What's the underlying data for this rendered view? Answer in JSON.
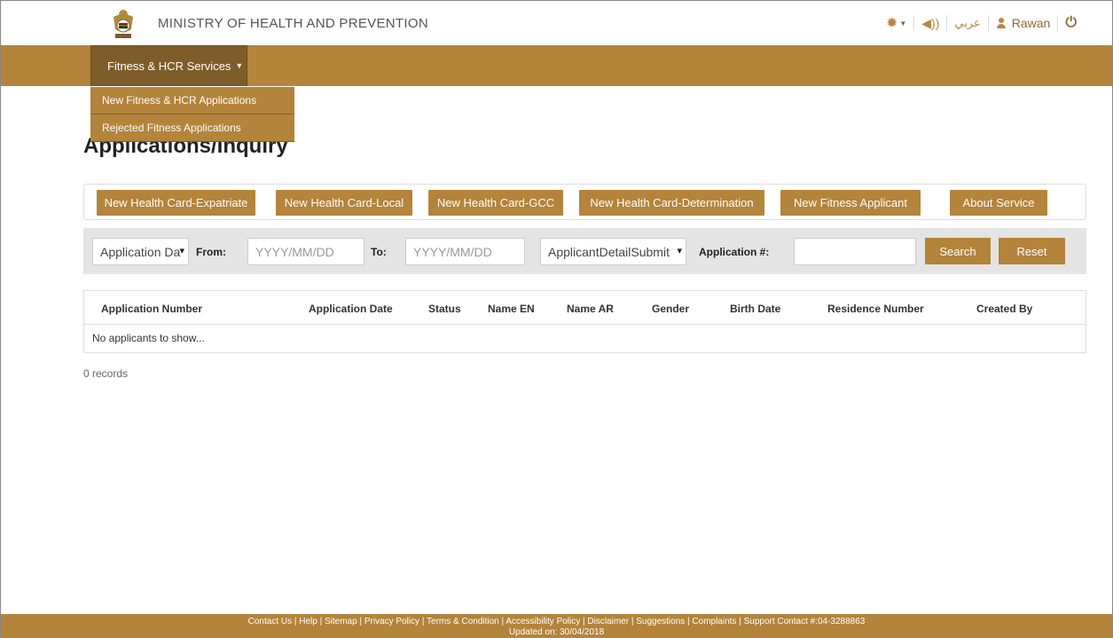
{
  "header": {
    "ministry": "MINISTRY OF HEALTH AND PREVENTION",
    "language": "عربي",
    "user": "Rawan",
    "icons": [
      "gear-icon",
      "speaker-icon",
      "user-icon",
      "power-icon"
    ]
  },
  "nav": {
    "menu_label": "Fitness & HCR Services",
    "dropdown": [
      "New Fitness & HCR Applications",
      "Rejected Fitness Applications"
    ]
  },
  "page": {
    "title": "Applications/Inquiry"
  },
  "actions": [
    "New Health Card-Expatriate",
    "New Health Card-Local",
    "New Health Card-GCC",
    "New Health Card-Determination",
    "New Fitness Applicant",
    "About Service"
  ],
  "filter": {
    "date_type": "Application Da",
    "from_label": "From:",
    "from_placeholder": "YYYY/MM/DD",
    "to_label": "To:",
    "to_placeholder": "YYYY/MM/DD",
    "status": "ApplicantDetailSubmit",
    "app_no_label": "Application #:",
    "app_no_value": "",
    "search": "Search",
    "reset": "Reset"
  },
  "table": {
    "columns": [
      "Application Number",
      "Application Date",
      "Status",
      "Name EN",
      "Name AR",
      "Gender",
      "Birth Date",
      "Residence Number",
      "Created By"
    ],
    "empty_text": "No applicants to show..."
  },
  "records": "0 records",
  "footer": {
    "links": "Contact Us | Help | Sitemap | Privacy Policy | Terms & Condition | Accessibility Policy | Disclaimer | Suggestions | Complaints |  Support Contact #:04-3288863",
    "updated": "Updated on: 30/04/2018"
  },
  "colors": {
    "brand": "#b3843a",
    "brand_dark": "#7d5d2a"
  }
}
